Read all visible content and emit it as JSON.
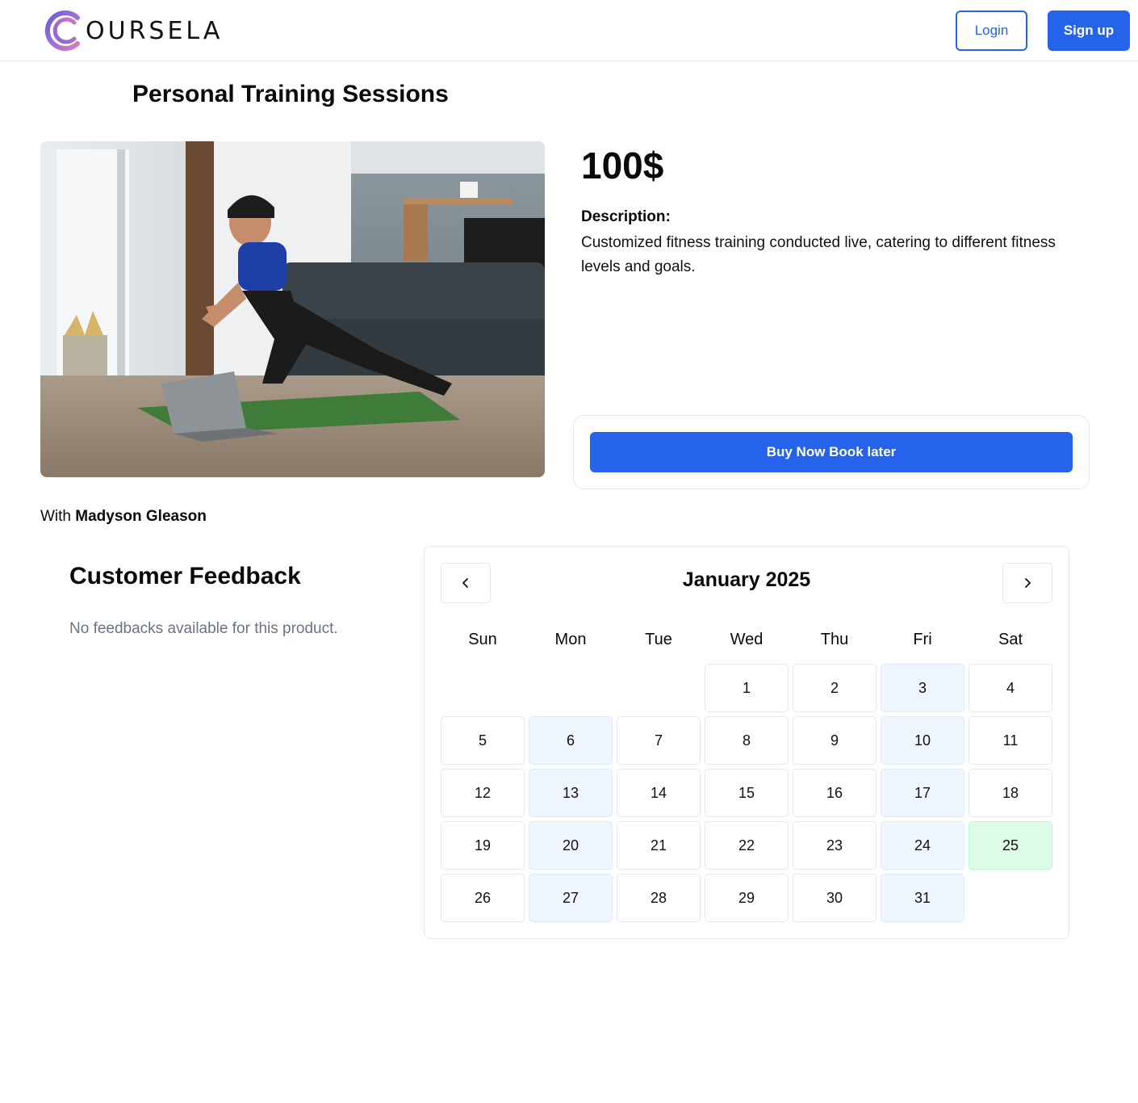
{
  "header": {
    "logo_text": "OURSELA",
    "login_label": "Login",
    "signup_label": "Sign up"
  },
  "product": {
    "title": "Personal Training Sessions",
    "price": "100$",
    "description_label": "Description:",
    "description": "Customized fitness training conducted live, catering to different fitness levels and goals.",
    "buy_label": "Buy Now Book later",
    "instructor_prefix": "With ",
    "instructor_name": "Madyson Gleason"
  },
  "feedback": {
    "title": "Customer Feedback",
    "empty_text": "No feedbacks available for this product."
  },
  "calendar": {
    "month_label": "January 2025",
    "weekdays": [
      "Sun",
      "Mon",
      "Tue",
      "Wed",
      "Thu",
      "Fri",
      "Sat"
    ],
    "first_weekday_index": 3,
    "days_in_month": 31,
    "highlighted_days": [
      3,
      6,
      10,
      13,
      17,
      20,
      24,
      27,
      31
    ],
    "selected_day": 25
  },
  "colors": {
    "accent": "#2563eb",
    "available_day": "#eff6ff",
    "selected_day": "#dcfce7"
  }
}
